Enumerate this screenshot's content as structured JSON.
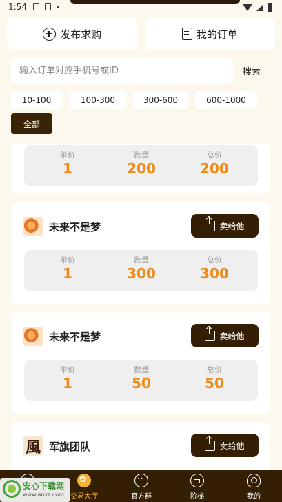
{
  "status_bar": {
    "time": "1:54"
  },
  "top_actions": {
    "publish_label": "发布求购",
    "orders_label": "我的订单"
  },
  "search": {
    "placeholder": "输入订单对应手机号或ID",
    "button_label": "搜索"
  },
  "filters": [
    "10-100",
    "100-300",
    "300-600",
    "600-1000",
    "全部"
  ],
  "filter_selected": "全部",
  "stat_labels": {
    "price": "单价",
    "quantity": "数量",
    "total": "总价"
  },
  "sell_label": "卖给他",
  "listings": [
    {
      "seller": "",
      "price": "1",
      "quantity": "200",
      "total": "200"
    },
    {
      "seller": "未来不是梦",
      "price": "1",
      "quantity": "300",
      "total": "300"
    },
    {
      "seller": "未来不是梦",
      "price": "1",
      "quantity": "50",
      "total": "50"
    },
    {
      "seller": "军旗团队",
      "avatar_glyph": "風"
    }
  ],
  "bottom_nav": [
    {
      "label": "",
      "icon": "deal-icon"
    },
    {
      "label": "交易大厅",
      "icon": "hall-icon",
      "active": true
    },
    {
      "label": "官方群",
      "icon": "chat-icon"
    },
    {
      "label": "阶梯",
      "icon": "ladder-icon"
    },
    {
      "label": "我的",
      "icon": "user-icon"
    }
  ],
  "watermark": {
    "title": "安心下载网",
    "url": "www.anxz.com"
  },
  "colors": {
    "background": "#fdf8ee",
    "dark_brown": "#341f05",
    "accent_orange": "#f08a16",
    "active_yellow": "#f3b233"
  }
}
